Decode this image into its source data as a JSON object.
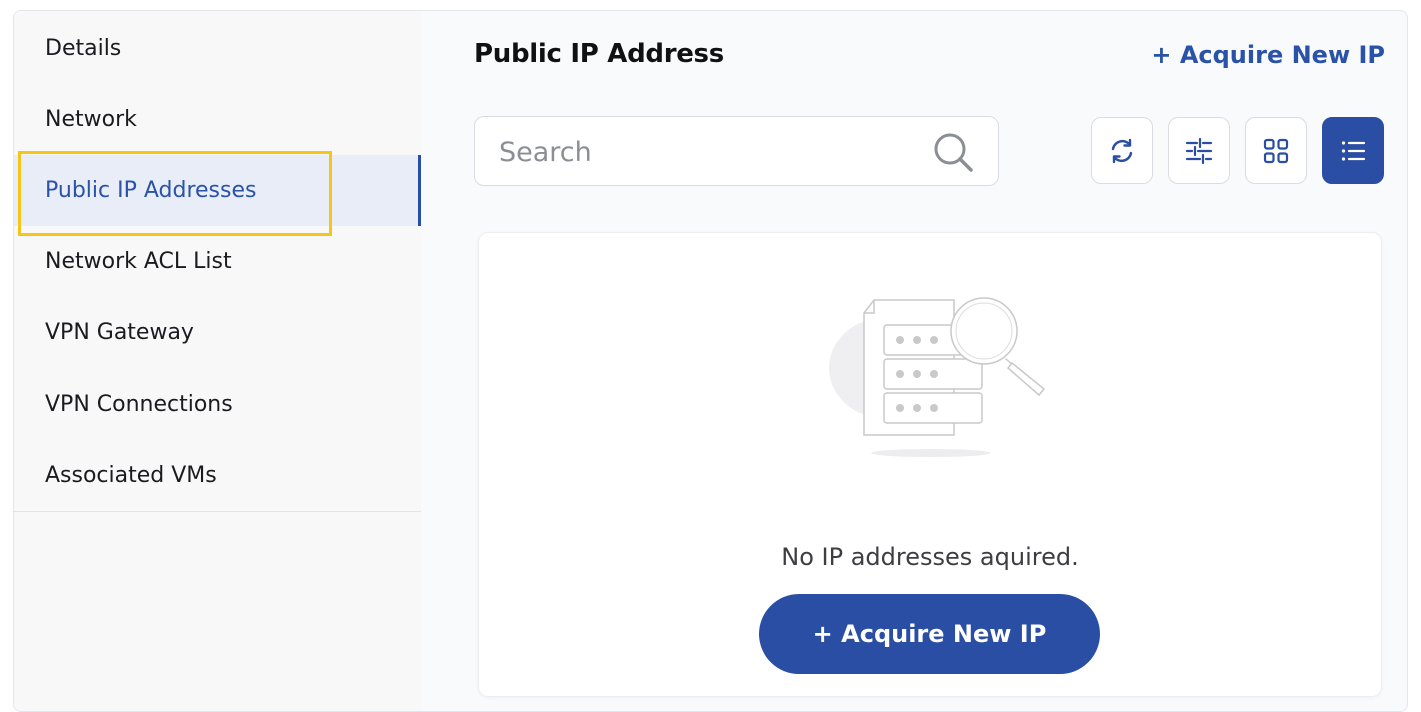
{
  "sidebar": {
    "items": [
      {
        "label": "Details"
      },
      {
        "label": "Network"
      },
      {
        "label": "Public IP Addresses",
        "active": true
      },
      {
        "label": "Network ACL List"
      },
      {
        "label": "VPN Gateway"
      },
      {
        "label": "VPN Connections"
      },
      {
        "label": "Associated VMs"
      }
    ]
  },
  "header": {
    "title": "Public IP Address",
    "acquire_link_label": "+ Acquire New IP"
  },
  "search": {
    "placeholder": "Search",
    "value": ""
  },
  "toolbar": {
    "buttons": [
      {
        "icon": "refresh-icon"
      },
      {
        "icon": "filter-sliders-icon"
      },
      {
        "icon": "grid-view-icon"
      },
      {
        "icon": "list-view-icon",
        "active": true
      }
    ]
  },
  "empty_state": {
    "message": "No IP addresses aquired.",
    "button_label": "+ Acquire New IP"
  },
  "colors": {
    "accent": "#2a4ea3",
    "highlight": "#f5c518",
    "active_bg": "#e8edf7"
  }
}
